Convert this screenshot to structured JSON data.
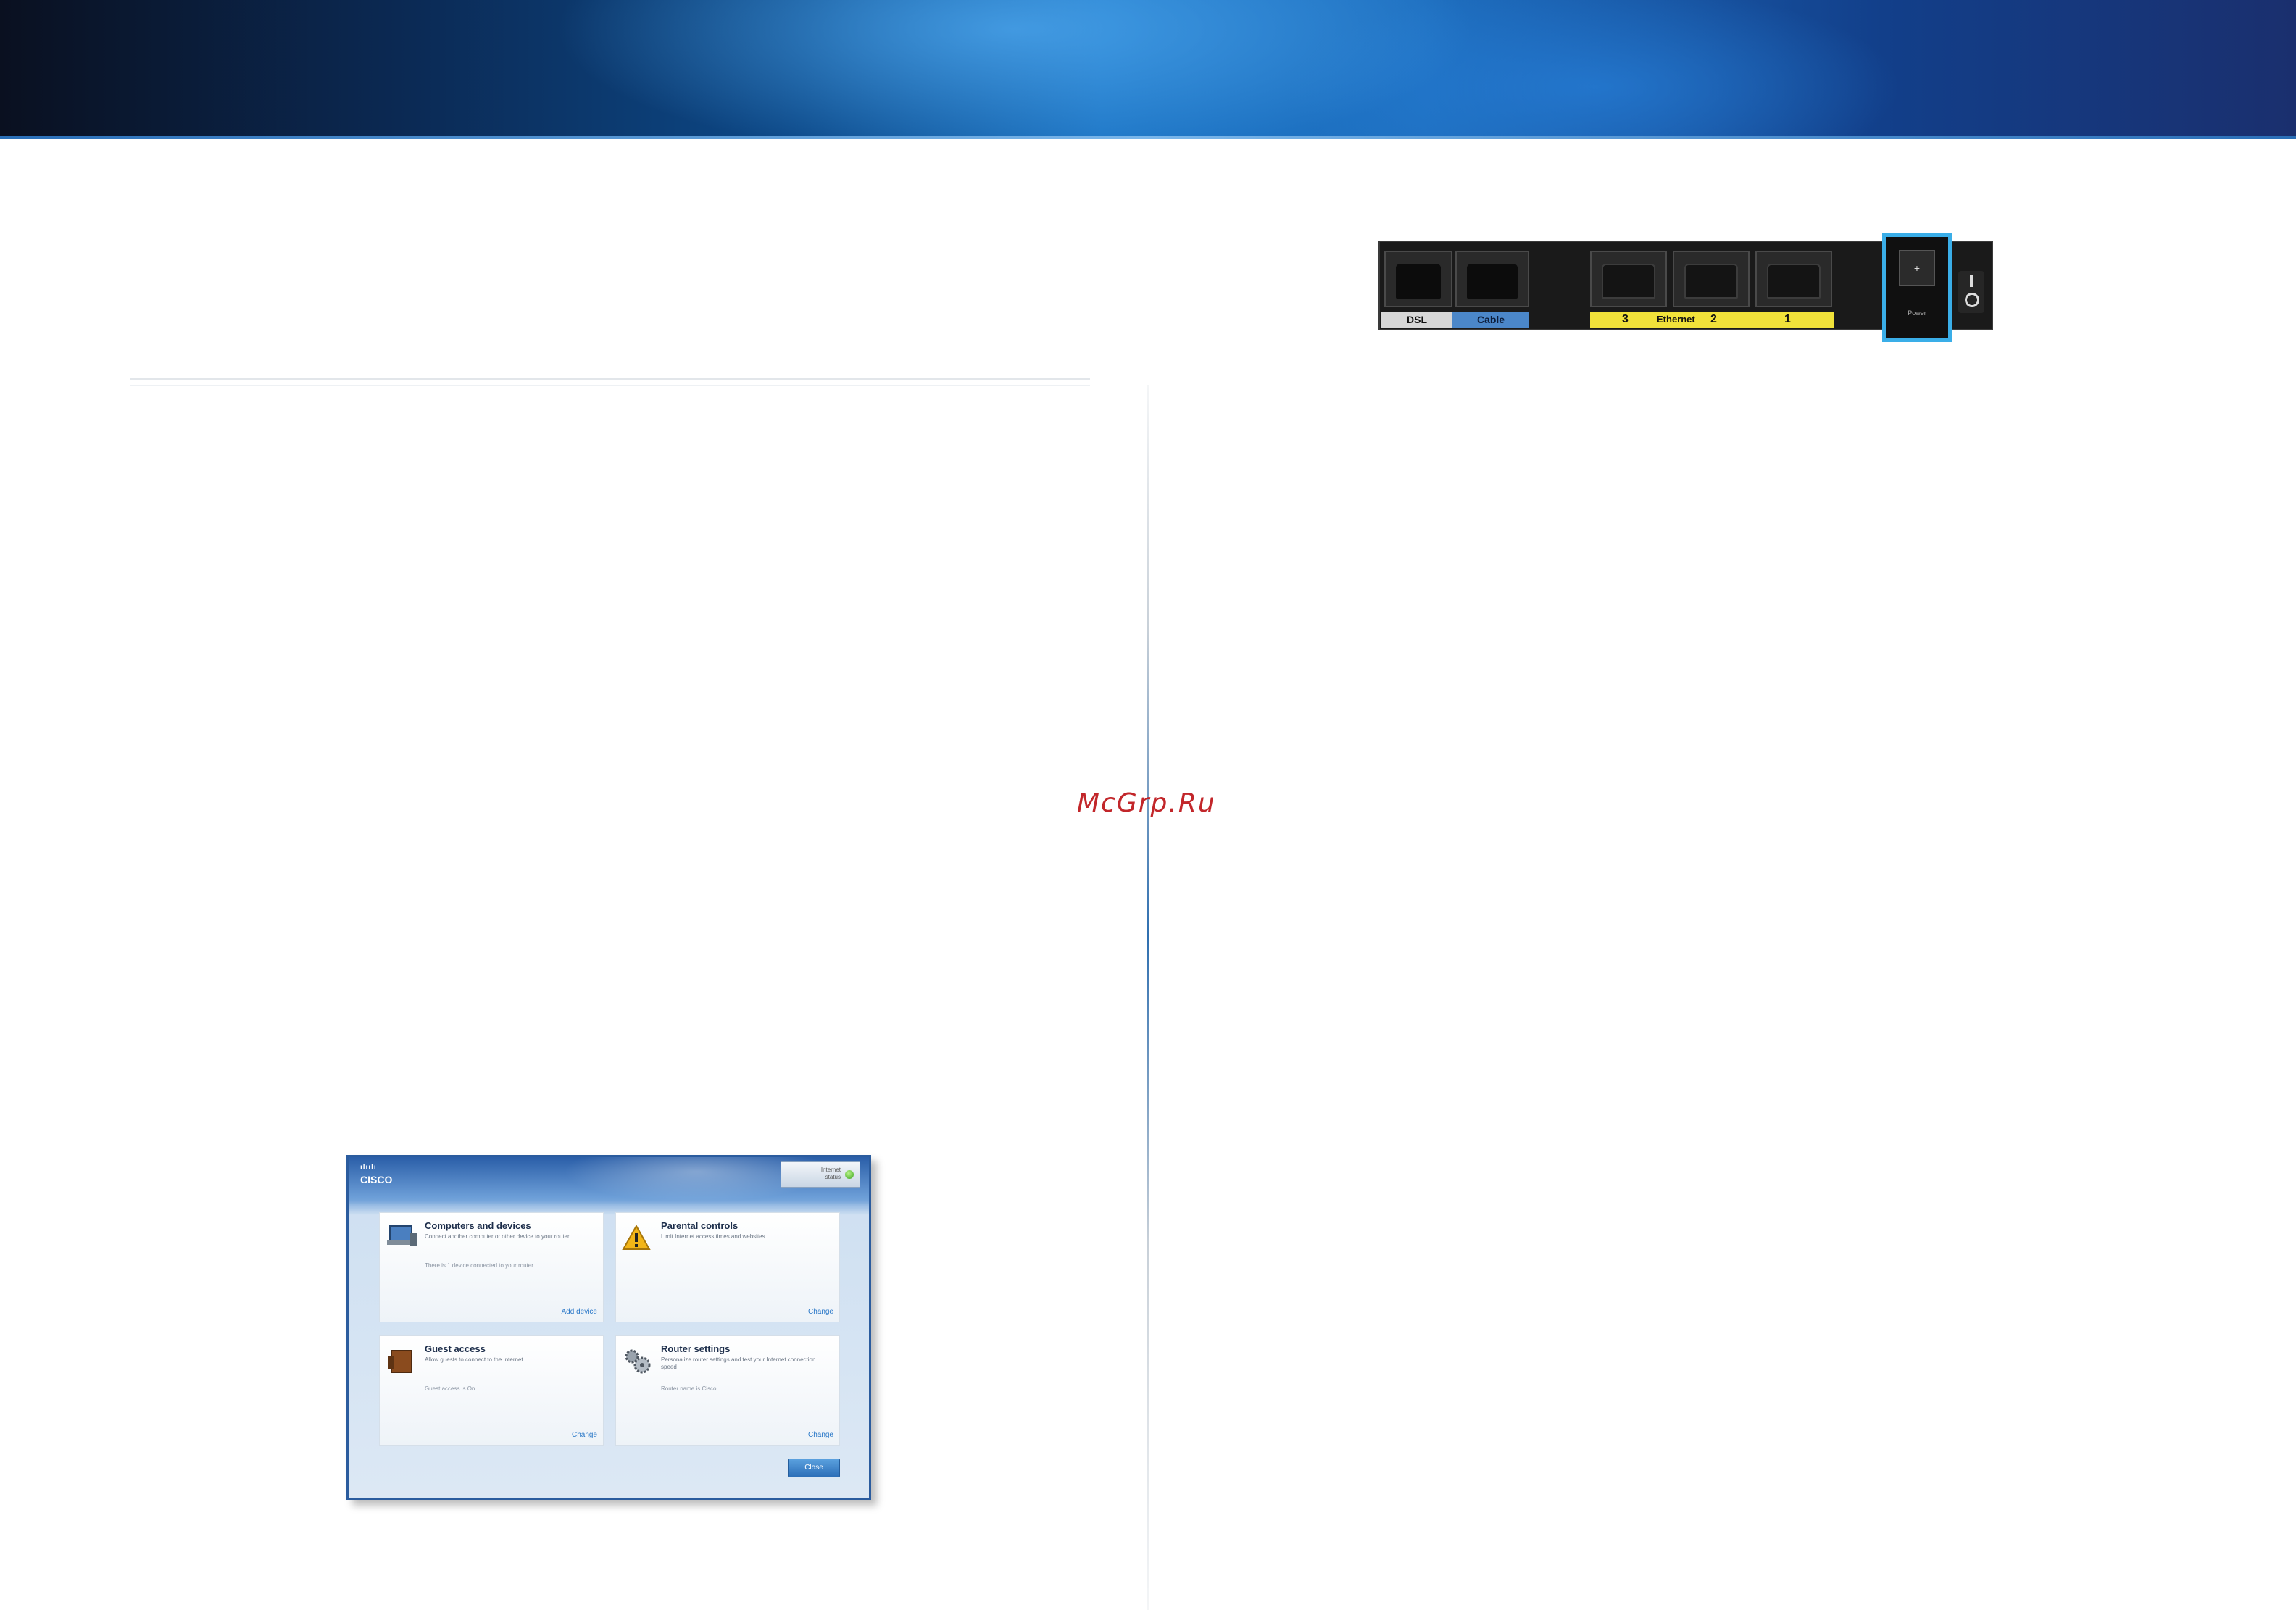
{
  "watermark": "McGrp.Ru",
  "router_panel": {
    "ports": {
      "dsl": "DSL",
      "cable": "Cable",
      "ethernet_label": "Ethernet",
      "ethernet_numbers": [
        "3",
        "2",
        "1"
      ],
      "power": "Power"
    },
    "highlight_color": "#3aaee8",
    "ethernet_strip_color": "#f1e23a",
    "cable_strip_color": "#4b87c9"
  },
  "cisco_window": {
    "logo": "CISCO",
    "logo_bars": "ılıılı",
    "status_line1": "Internet",
    "status_line2": "status",
    "tiles": [
      {
        "title": "Computers and devices",
        "desc": "Connect another computer or other device to your router",
        "desc2": "There is 1 device connected to your router",
        "link": "Add device"
      },
      {
        "title": "Parental controls",
        "desc": "Limit Internet access times and websites",
        "desc2": "",
        "link": "Change"
      },
      {
        "title": "Guest access",
        "desc": "Allow guests to connect to the Internet",
        "desc2": "Guest access is On",
        "link": "Change"
      },
      {
        "title": "Router settings",
        "desc": "Personalize router settings and test your Internet connection speed",
        "desc2": "Router name is Cisco",
        "link": "Change"
      }
    ],
    "close_label": "Close"
  }
}
